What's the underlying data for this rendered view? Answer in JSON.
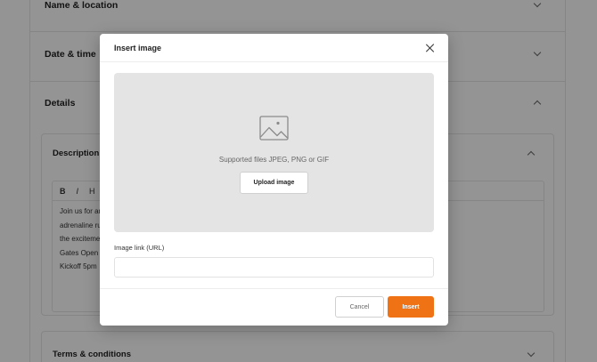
{
  "background": {
    "sections": {
      "name_location": "Name & location",
      "date_time": "Date & time",
      "details": "Details"
    },
    "description": {
      "title": "Description",
      "toolbar": {
        "bold": "B",
        "italic": "I",
        "heading": "H"
      },
      "lines": [
        "Join us for an",
        "adrenaline ru",
        "the exciteme",
        "Gates Open",
        "Kickoff 5pm"
      ]
    },
    "terms": {
      "title": "Terms & conditions"
    }
  },
  "modal": {
    "title": "Insert image",
    "dropzone": {
      "icon": "image-icon",
      "supported_text": "Supported files JPEG, PNG or GIF",
      "upload_label": "Upload image"
    },
    "url": {
      "label": "Image link (URL)",
      "value": "",
      "placeholder": ""
    },
    "cancel_label": "Cancel",
    "insert_label": "Insert"
  },
  "colors": {
    "accent": "#ef7215",
    "overlay": "rgba(0,0,0,0.42)",
    "dropzone": "#e4e4e4"
  }
}
